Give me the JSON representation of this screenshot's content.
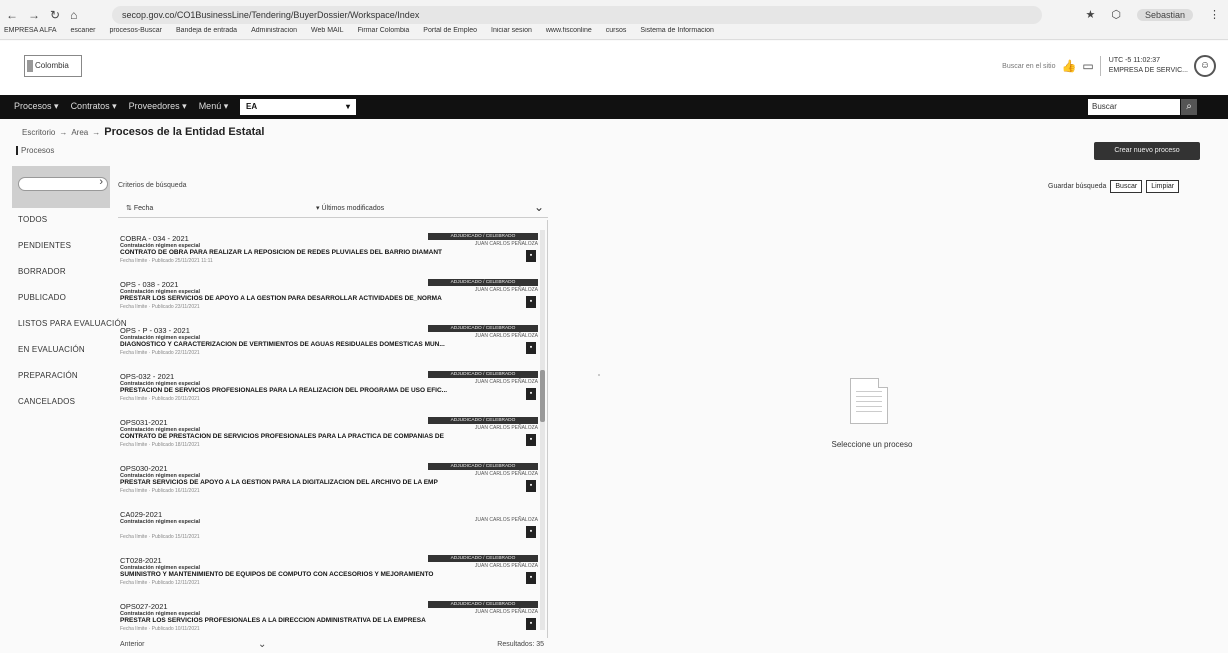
{
  "browser": {
    "url": "secop.gov.co/CO1BusinessLine/Tendering/BuyerDossier/Workspace/Index",
    "profile": "Sebastian",
    "bookmarks": [
      "EMPRESA ALFA",
      "escaner",
      "procesos-Buscar",
      "Bandeja de entrada",
      "Administracion",
      "Web MAIL",
      "Firmar Colombia",
      "Portal de Empleo",
      "Iniciar sesion",
      "www.fisconline",
      "cursos",
      "Sistema de Informacion"
    ]
  },
  "header": {
    "logo": "Colombia",
    "link": "Buscar en el sitio",
    "user_line1": "UTC -5 11:02:37",
    "user_line2": "EMPRESA DE SERVIC..."
  },
  "topnav": {
    "menu": [
      "Procesos",
      "Contratos",
      "Proveedores",
      "Menú"
    ],
    "entity": "EA",
    "search_placeholder": "Buscar"
  },
  "breadcrumb": {
    "items": [
      "Escritorio",
      "Area"
    ],
    "title": "Procesos de la Entidad Estatal"
  },
  "section_label": "Procesos",
  "new_process_label": "Crear nuevo proceso",
  "sidebar": {
    "statuses": [
      "TODOS",
      "PENDIENTES",
      "BORRADOR",
      "PUBLICADO",
      "LISTOS PARA EVALUACIÓN",
      "EN EVALUACIÓN",
      "PREPARACIÓN",
      "CANCELADOS"
    ]
  },
  "list": {
    "search_criteria": "Criterios de búsqueda",
    "sort_by": "Fecha",
    "sort_order": "Últimos modificados",
    "processes": [
      {
        "ref": "COBRA - 034 - 2021",
        "mod": "Contratación régimen especial",
        "desc": "CONTRATO DE OBRA PARA REALIZAR LA REPOSICION DE REDES PLUVIALES DEL BARRIO DIAMANT",
        "meta": "Fecha límite  ·  Publicado 25/11/2021 11:11",
        "badge": "ADJUDICADO / CELEBRADO",
        "owner": "JUAN CARLOS PEÑALOZA"
      },
      {
        "ref": "OPS - 038 - 2021",
        "mod": "Contratación régimen especial",
        "desc": "PRESTAR LOS SERVICIOS DE APOYO A LA GESTION PARA DESARROLLAR ACTIVIDADES DE_NORMA",
        "meta": "Fecha límite  ·  Publicado 23/11/2021",
        "badge": "ADJUDICADO / CELEBRADO",
        "owner": "JUAN CARLOS PEÑALOZA"
      },
      {
        "ref": "OPS - P - 033 - 2021",
        "mod": "Contratación régimen especial",
        "desc": "DIAGNOSTICO Y CARACTERIZACION DE VERTIMIENTOS DE AGUAS RESIDUALES DOMESTICAS MUN...",
        "meta": "Fecha límite  ·  Publicado 22/11/2021",
        "badge": "ADJUDICADO / CELEBRADO",
        "owner": "JUAN CARLOS PEÑALOZA"
      },
      {
        "ref": "OPS-032 - 2021",
        "mod": "Contratación régimen especial",
        "desc": "PRESTACION DE SERVICIOS PROFESIONALES PARA LA REALIZACION DEL PROGRAMA DE USO EFIC...",
        "meta": "Fecha límite  ·  Publicado 20/11/2021",
        "badge": "ADJUDICADO / CELEBRADO",
        "owner": "JUAN CARLOS PEÑALOZA"
      },
      {
        "ref": "OPS031-2021",
        "mod": "Contratación régimen especial",
        "desc": "CONTRATO DE PRESTACION DE SERVICIOS PROFESIONALES PARA LA PRACTICA DE COMPAÑIAS DE",
        "meta": "Fecha límite  ·  Publicado 18/11/2021",
        "badge": "ADJUDICADO / CELEBRADO",
        "owner": "JUAN CARLOS PEÑALOZA"
      },
      {
        "ref": "OPS030-2021",
        "mod": "Contratación régimen especial",
        "desc": "PRESTAR SERVICIOS DE APOYO A LA GESTION PARA LA DIGITALIZACION DEL ARCHIVO DE LA EMP",
        "meta": "Fecha límite  ·  Publicado 16/11/2021",
        "badge": "ADJUDICADO / CELEBRADO",
        "owner": "JUAN CARLOS PEÑALOZA"
      },
      {
        "ref": "CA029-2021",
        "mod": "Contratación régimen especial",
        "desc": "",
        "meta": "Fecha límite  ·  Publicado 15/11/2021",
        "badge": "",
        "owner": "JUAN CARLOS PEÑALOZA"
      },
      {
        "ref": "CT028-2021",
        "mod": "Contratación régimen especial",
        "desc": "SUMINISTRO Y MANTENIMIENTO DE EQUIPOS DE COMPUTO CON ACCESORIOS Y MEJORAMIENTO",
        "meta": "Fecha límite  ·  Publicado 12/11/2021",
        "badge": "ADJUDICADO / CELEBRADO",
        "owner": "JUAN CARLOS PEÑALOZA"
      },
      {
        "ref": "OPS027-2021",
        "mod": "Contratación régimen especial",
        "desc": "PRESTAR LOS SERVICIOS PROFESIONALES A LA DIRECCION ADMINISTRATIVA DE LA EMPRESA",
        "meta": "Fecha límite  ·  Publicado 10/11/2021",
        "badge": "ADJUDICADO / CELEBRADO",
        "owner": "JUAN CARLOS PEÑALOZA"
      }
    ],
    "footer_left": "Anterior",
    "footer_right": "Resultados: 35"
  },
  "filter_actions": {
    "link": "Guardar búsqueda",
    "search": "Buscar",
    "clear": "Limpiar"
  },
  "empty_state": "Seleccione un proceso"
}
